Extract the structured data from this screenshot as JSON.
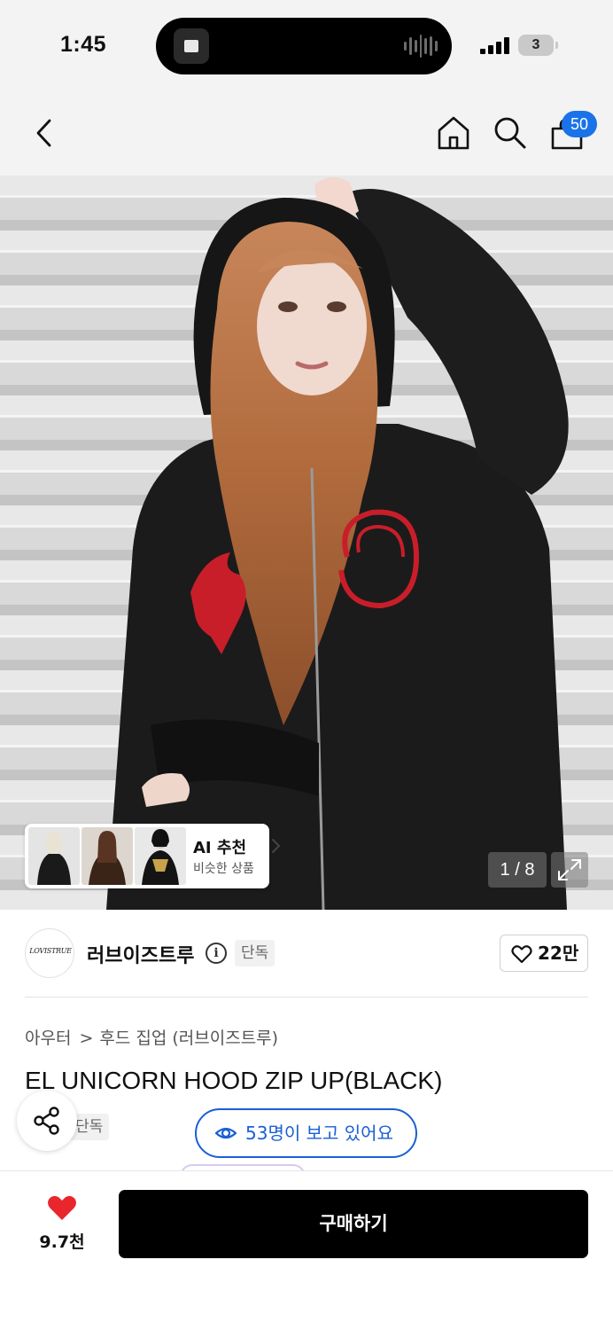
{
  "status_bar": {
    "time": "1:45",
    "battery": "3",
    "signal_bars": 4
  },
  "nav": {
    "back_icon": "chevron-left-icon",
    "home_icon": "home-icon",
    "search_icon": "search-icon",
    "cart_icon": "shopping-bag-icon",
    "cart_badge": "50"
  },
  "gallery": {
    "page_current": 1,
    "page_total": 8,
    "page_counter": "1 / 8",
    "expand_icon": "expand-icon",
    "ai_card": {
      "title": "AI 추천",
      "subtitle": "비슷한 상품",
      "thumbnail_count": 3
    }
  },
  "brand": {
    "logo_text": "LOVISTRUE",
    "name": "러브이즈트루",
    "info_icon": "info-icon",
    "exclusive_tag": "단독",
    "like_count": "22만"
  },
  "product": {
    "breadcrumb": [
      "아우터",
      "후드 집업 (러브이즈트루)"
    ],
    "title": "EL UNICORN HOOD ZIP UP(BLACK)",
    "exclusive_tag": "단독"
  },
  "viewers": {
    "text": "53명이 보고 있어요",
    "icon": "eye-icon"
  },
  "share": {
    "icon": "share-icon"
  },
  "bottom_bar": {
    "wish_count": "9.7천",
    "buy_label": "구매하기"
  },
  "colors": {
    "accent_blue": "#1a5fd6",
    "badge_blue": "#1a73e8",
    "heart_red": "#e8262b",
    "buy_button": "#000000"
  }
}
